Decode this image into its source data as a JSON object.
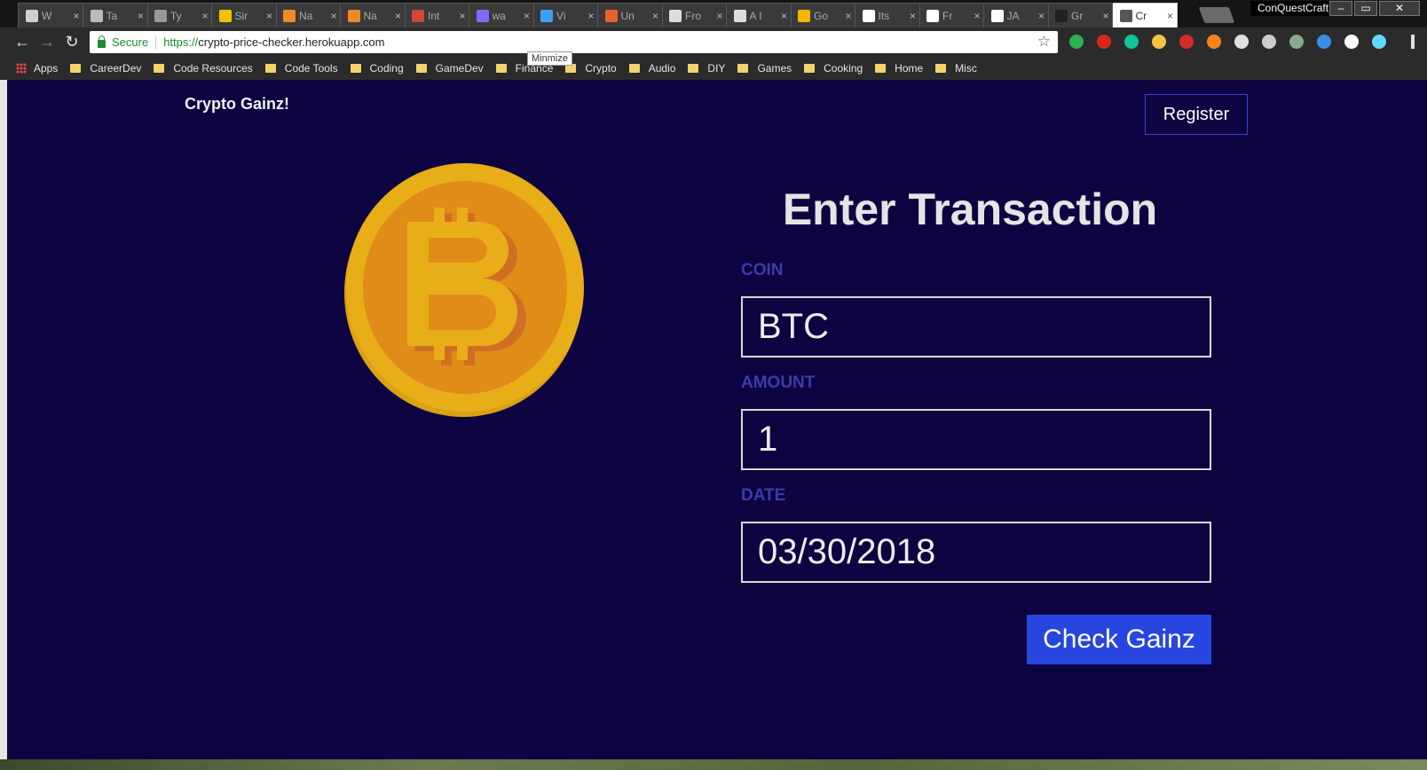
{
  "browser": {
    "tabs": [
      {
        "title": "W",
        "icon": "page-icon",
        "color": "#cfcfcf"
      },
      {
        "title": "Ta",
        "icon": "notes-icon",
        "color": "#bbbbbb"
      },
      {
        "title": "Ty",
        "icon": "t-icon",
        "color": "#999999"
      },
      {
        "title": "Sir",
        "icon": "s-icon",
        "color": "#f2c200"
      },
      {
        "title": "Na",
        "icon": "heart-icon",
        "color": "#f08a24"
      },
      {
        "title": "Na",
        "icon": "heart-icon",
        "color": "#f08a24"
      },
      {
        "title": "Int",
        "icon": "gmail-icon",
        "color": "#d44638"
      },
      {
        "title": "wa",
        "icon": "mail-icon",
        "color": "#7b6cf6"
      },
      {
        "title": "Vi",
        "icon": "filter-icon",
        "color": "#3da0f5"
      },
      {
        "title": "Un",
        "icon": "e-icon",
        "color": "#e8602c"
      },
      {
        "title": "Fro",
        "icon": "github-icon",
        "color": "#dddddd"
      },
      {
        "title": "A I",
        "icon": "github-icon",
        "color": "#dddddd"
      },
      {
        "title": "Go",
        "icon": "adwords-icon",
        "color": "#f4b400"
      },
      {
        "title": "Its",
        "icon": "w-icon",
        "color": "#ffffff"
      },
      {
        "title": "Fr",
        "icon": "c-icon",
        "color": "#ffffff"
      },
      {
        "title": "JA",
        "icon": "t-square-icon",
        "color": "#ffffff"
      },
      {
        "title": "Gr",
        "icon": "g-icon",
        "color": "#222222"
      },
      {
        "title": "Cr",
        "icon": "page-icon",
        "color": "#555555",
        "active": true
      }
    ],
    "profile_name": "ConQuestCraft",
    "window_controls": {
      "minimize": "–",
      "maximize": "▭",
      "close": "✕"
    },
    "tooltip": "Minmize",
    "nav": {
      "back": "←",
      "forward": "→",
      "reload": "↻"
    },
    "secure_label": "Secure",
    "url_scheme": "https://",
    "url_host": "crypto-price-checker.herokuapp.com",
    "star": "☆",
    "extensions": [
      {
        "name": "chrome-ext-icon",
        "color": "#2bb24c"
      },
      {
        "name": "adblock-icon",
        "color": "#d9261c"
      },
      {
        "name": "grammarly-icon",
        "color": "#15c39a"
      },
      {
        "name": "bulb-icon",
        "color": "#f6c342"
      },
      {
        "name": "lastpass-icon",
        "color": "#d32d27"
      },
      {
        "name": "metamask-icon",
        "color": "#f6851b"
      },
      {
        "name": "circle-icon",
        "color": "#e0e0e0"
      },
      {
        "name": "function-icon",
        "color": "#cccccc"
      },
      {
        "name": "pen-icon",
        "color": "#88aa88"
      },
      {
        "name": "dash-icon",
        "color": "#3a8ee6"
      },
      {
        "name": "white-circle-icon",
        "color": "#ffffff"
      },
      {
        "name": "react-icon",
        "color": "#61dafb"
      },
      {
        "name": "menu-icon",
        "color": "#e0e0e0"
      }
    ],
    "bookmarks": [
      {
        "label": "Apps",
        "kind": "apps"
      },
      {
        "label": "CareerDev"
      },
      {
        "label": "Code Resources"
      },
      {
        "label": "Code Tools"
      },
      {
        "label": "Coding"
      },
      {
        "label": "GameDev"
      },
      {
        "label": "Finance"
      },
      {
        "label": "Crypto"
      },
      {
        "label": "Audio"
      },
      {
        "label": "DIY"
      },
      {
        "label": "Games"
      },
      {
        "label": "Cooking"
      },
      {
        "label": "Home"
      },
      {
        "label": "Misc"
      }
    ]
  },
  "app": {
    "brand": "Crypto Gainz!",
    "register_label": "Register",
    "heading": "Enter Transaction",
    "fields": {
      "coin": {
        "label": "COIN",
        "value": "BTC"
      },
      "amount": {
        "label": "AMOUNT",
        "value": "1"
      },
      "date": {
        "label": "DATE",
        "value": "03/30/2018"
      }
    },
    "submit_label": "Check Gainz",
    "colors": {
      "background": "#0d0340",
      "label": "#3c3ca8",
      "button": "#2746e0",
      "coin_outer": "#e2a817",
      "coin_inner": "#e08c19"
    },
    "coin_icon": "bitcoin-icon"
  }
}
